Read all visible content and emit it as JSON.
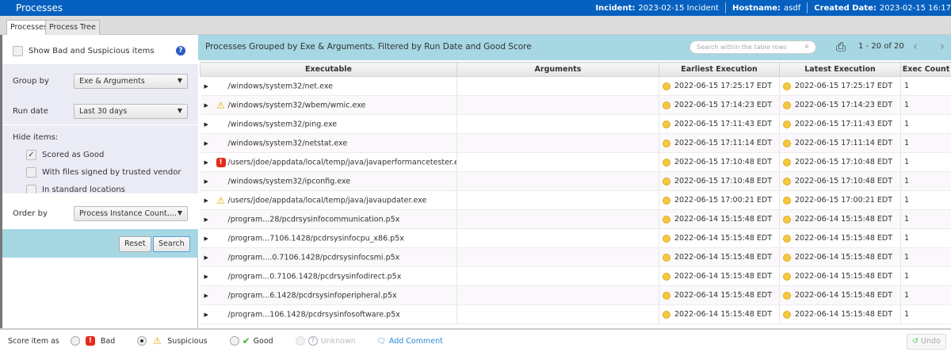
{
  "header": {
    "title": "Processes",
    "incident_label": "Incident:",
    "incident": "2023-02-15 Incident",
    "hostname_label": "Hostname:",
    "hostname": "asdf",
    "created_label": "Created Date:",
    "created": "2023-02-15 16:17"
  },
  "tabs": [
    "Processes",
    "Process Tree"
  ],
  "filters": {
    "show_bad": "Show Bad and Suspicious items",
    "show_bad_checked": false,
    "group_by_label": "Group by",
    "group_by": "Exe & Arguments",
    "run_date_label": "Run date",
    "run_date": "Last 30 days",
    "hide_label": "Hide items:",
    "hide_items": [
      {
        "label": "Scored as Good",
        "checked": true
      },
      {
        "label": "With files signed by trusted vendor",
        "checked": false
      },
      {
        "label": "In standard locations",
        "checked": false
      }
    ],
    "order_by_label": "Order by",
    "order_by": "Process Instance Count,...",
    "reset": "Reset",
    "search": "Search"
  },
  "main": {
    "title": "Processes Grouped by Exe & Arguments. Filtered by Run Date and Good Score",
    "search_placeholder": "Search within the table rows",
    "pager": "1 - 20 of 20",
    "columns": [
      "Executable",
      "Arguments",
      "Earliest Execution",
      "Latest Execution",
      "Exec Count"
    ],
    "rows": [
      {
        "score": "",
        "exe": "/windows/system32/net.exe",
        "args": "",
        "earliest": "2022-06-15 17:25:17 EDT",
        "latest": "2022-06-15 17:25:17 EDT",
        "count": "1"
      },
      {
        "score": "suspicious",
        "exe": "/windows/system32/wbem/wmic.exe",
        "args": "",
        "earliest": "2022-06-15 17:14:23 EDT",
        "latest": "2022-06-15 17:14:23 EDT",
        "count": "1"
      },
      {
        "score": "",
        "exe": "/windows/system32/ping.exe",
        "args": "",
        "earliest": "2022-06-15 17:11:43 EDT",
        "latest": "2022-06-15 17:11:43 EDT",
        "count": "1"
      },
      {
        "score": "",
        "exe": "/windows/system32/netstat.exe",
        "args": "",
        "earliest": "2022-06-15 17:11:14 EDT",
        "latest": "2022-06-15 17:11:14 EDT",
        "count": "1"
      },
      {
        "score": "bad",
        "exe": "/users/jdoe/appdata/local/temp/java/javaperformancetester.exe",
        "args": "",
        "earliest": "2022-06-15 17:10:48 EDT",
        "latest": "2022-06-15 17:10:48 EDT",
        "count": "1"
      },
      {
        "score": "",
        "exe": "/windows/system32/ipconfig.exe",
        "args": "",
        "earliest": "2022-06-15 17:10:48 EDT",
        "latest": "2022-06-15 17:10:48 EDT",
        "count": "1"
      },
      {
        "score": "suspicious",
        "exe": "/users/jdoe/appdata/local/temp/java/javaupdater.exe",
        "args": "",
        "earliest": "2022-06-15 17:00:21 EDT",
        "latest": "2022-06-15 17:00:21 EDT",
        "count": "1"
      },
      {
        "score": "",
        "exe": "/program...28/pcdrsysinfocommunication.p5x",
        "args": "",
        "earliest": "2022-06-14 15:15:48 EDT",
        "latest": "2022-06-14 15:15:48 EDT",
        "count": "1"
      },
      {
        "score": "",
        "exe": "/program...7106.1428/pcdrsysinfocpu_x86.p5x",
        "args": "",
        "earliest": "2022-06-14 15:15:48 EDT",
        "latest": "2022-06-14 15:15:48 EDT",
        "count": "1"
      },
      {
        "score": "",
        "exe": "/program....0.7106.1428/pcdrsysinfocsmi.p5x",
        "args": "",
        "earliest": "2022-06-14 15:15:48 EDT",
        "latest": "2022-06-14 15:15:48 EDT",
        "count": "1"
      },
      {
        "score": "",
        "exe": "/program...0.7106.1428/pcdrsysinfodirect.p5x",
        "args": "",
        "earliest": "2022-06-14 15:15:48 EDT",
        "latest": "2022-06-14 15:15:48 EDT",
        "count": "1"
      },
      {
        "score": "",
        "exe": "/program...6.1428/pcdrsysinfoperipheral.p5x",
        "args": "",
        "earliest": "2022-06-14 15:15:48 EDT",
        "latest": "2022-06-14 15:15:48 EDT",
        "count": "1"
      },
      {
        "score": "",
        "exe": "/program...106.1428/pcdrsysinfosoftware.p5x",
        "args": "",
        "earliest": "2022-06-14 15:15:48 EDT",
        "latest": "2022-06-14 15:15:48 EDT",
        "count": "1"
      }
    ]
  },
  "footer": {
    "score_label": "Score item as",
    "options": [
      {
        "label": "Bad",
        "selected": false
      },
      {
        "label": "Suspicious",
        "selected": true
      },
      {
        "label": "Good",
        "selected": false
      },
      {
        "label": "Unknown",
        "selected": false,
        "disabled": true
      }
    ],
    "add_comment": "Add Comment",
    "undo": "Undo"
  }
}
